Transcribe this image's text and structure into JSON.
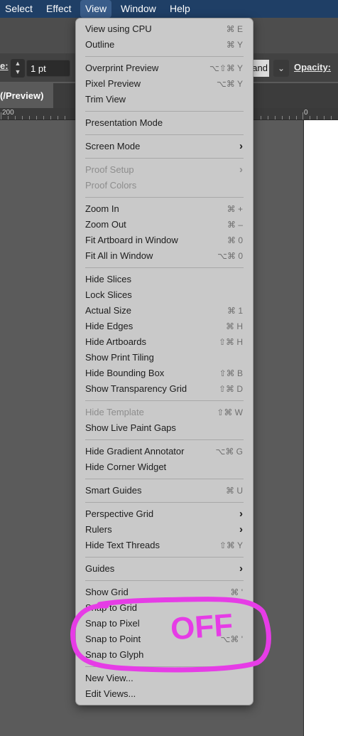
{
  "menubar": [
    {
      "label": "Select",
      "active": false
    },
    {
      "label": "Effect",
      "active": false
    },
    {
      "label": "View",
      "active": true
    },
    {
      "label": "Window",
      "active": false
    },
    {
      "label": "Help",
      "active": false
    }
  ],
  "toolbar": {
    "stroke_label": "e:",
    "stroke_value": "1 pt",
    "blend_value": "and",
    "opacity_label": "Opacity:"
  },
  "doc_tab": "(/Preview)",
  "ruler": {
    "left_label": "200",
    "right_label": "0"
  },
  "menu": {
    "items": [
      {
        "label": "View using CPU",
        "shortcut": "⌘ E"
      },
      {
        "label": "Outline",
        "shortcut": "⌘ Y"
      },
      {
        "sep": true
      },
      {
        "label": "Overprint Preview",
        "shortcut": "⌥⇧⌘ Y"
      },
      {
        "label": "Pixel Preview",
        "shortcut": "⌥⌘ Y"
      },
      {
        "label": "Trim View",
        "shortcut": ""
      },
      {
        "sep": true
      },
      {
        "label": "Presentation Mode",
        "shortcut": ""
      },
      {
        "sep": true
      },
      {
        "label": "Screen Mode",
        "submenu": true
      },
      {
        "sep": true
      },
      {
        "label": "Proof Setup",
        "submenu": true,
        "disabled": true
      },
      {
        "label": "Proof Colors",
        "disabled": true
      },
      {
        "sep": true
      },
      {
        "label": "Zoom In",
        "shortcut": "⌘ +"
      },
      {
        "label": "Zoom Out",
        "shortcut": "⌘ –"
      },
      {
        "label": "Fit Artboard in Window",
        "shortcut": "⌘ 0"
      },
      {
        "label": "Fit All in Window",
        "shortcut": "⌥⌘ 0"
      },
      {
        "sep": true
      },
      {
        "label": "Hide Slices",
        "shortcut": ""
      },
      {
        "label": "Lock Slices",
        "shortcut": ""
      },
      {
        "label": "Actual Size",
        "shortcut": "⌘ 1"
      },
      {
        "label": "Hide Edges",
        "shortcut": "⌘ H"
      },
      {
        "label": "Hide Artboards",
        "shortcut": "⇧⌘ H"
      },
      {
        "label": "Show Print Tiling",
        "shortcut": ""
      },
      {
        "label": "Hide Bounding Box",
        "shortcut": "⇧⌘ B"
      },
      {
        "label": "Show Transparency Grid",
        "shortcut": "⇧⌘ D"
      },
      {
        "sep": true
      },
      {
        "label": "Hide Template",
        "shortcut": "⇧⌘ W",
        "disabled": true
      },
      {
        "label": "Show Live Paint Gaps",
        "shortcut": ""
      },
      {
        "sep": true
      },
      {
        "label": "Hide Gradient Annotator",
        "shortcut": "⌥⌘ G"
      },
      {
        "label": "Hide Corner Widget",
        "shortcut": ""
      },
      {
        "sep": true
      },
      {
        "label": "Smart Guides",
        "shortcut": "⌘ U"
      },
      {
        "sep": true
      },
      {
        "label": "Perspective Grid",
        "submenu": true
      },
      {
        "label": "Rulers",
        "submenu": true
      },
      {
        "label": "Hide Text Threads",
        "shortcut": "⇧⌘ Y"
      },
      {
        "sep": true
      },
      {
        "label": "Guides",
        "submenu": true
      },
      {
        "sep": true
      },
      {
        "label": "Show Grid",
        "shortcut": "⌘ '"
      },
      {
        "label": "Snap to Grid",
        "shortcut": ""
      },
      {
        "label": "Snap to Pixel",
        "shortcut": ""
      },
      {
        "label": "Snap to Point",
        "shortcut": "⌥⌘ '"
      },
      {
        "label": "Snap to Glyph",
        "shortcut": ""
      },
      {
        "sep": true
      },
      {
        "label": "New View...",
        "shortcut": ""
      },
      {
        "label": "Edit Views...",
        "shortcut": ""
      }
    ]
  },
  "annotation": {
    "text": "OFF",
    "color": "#e63ce6"
  },
  "icons": {
    "submenu": "chevron-right-icon",
    "stepper": "stepper-arrows-icon",
    "dropdown": "chevron-down-icon"
  }
}
